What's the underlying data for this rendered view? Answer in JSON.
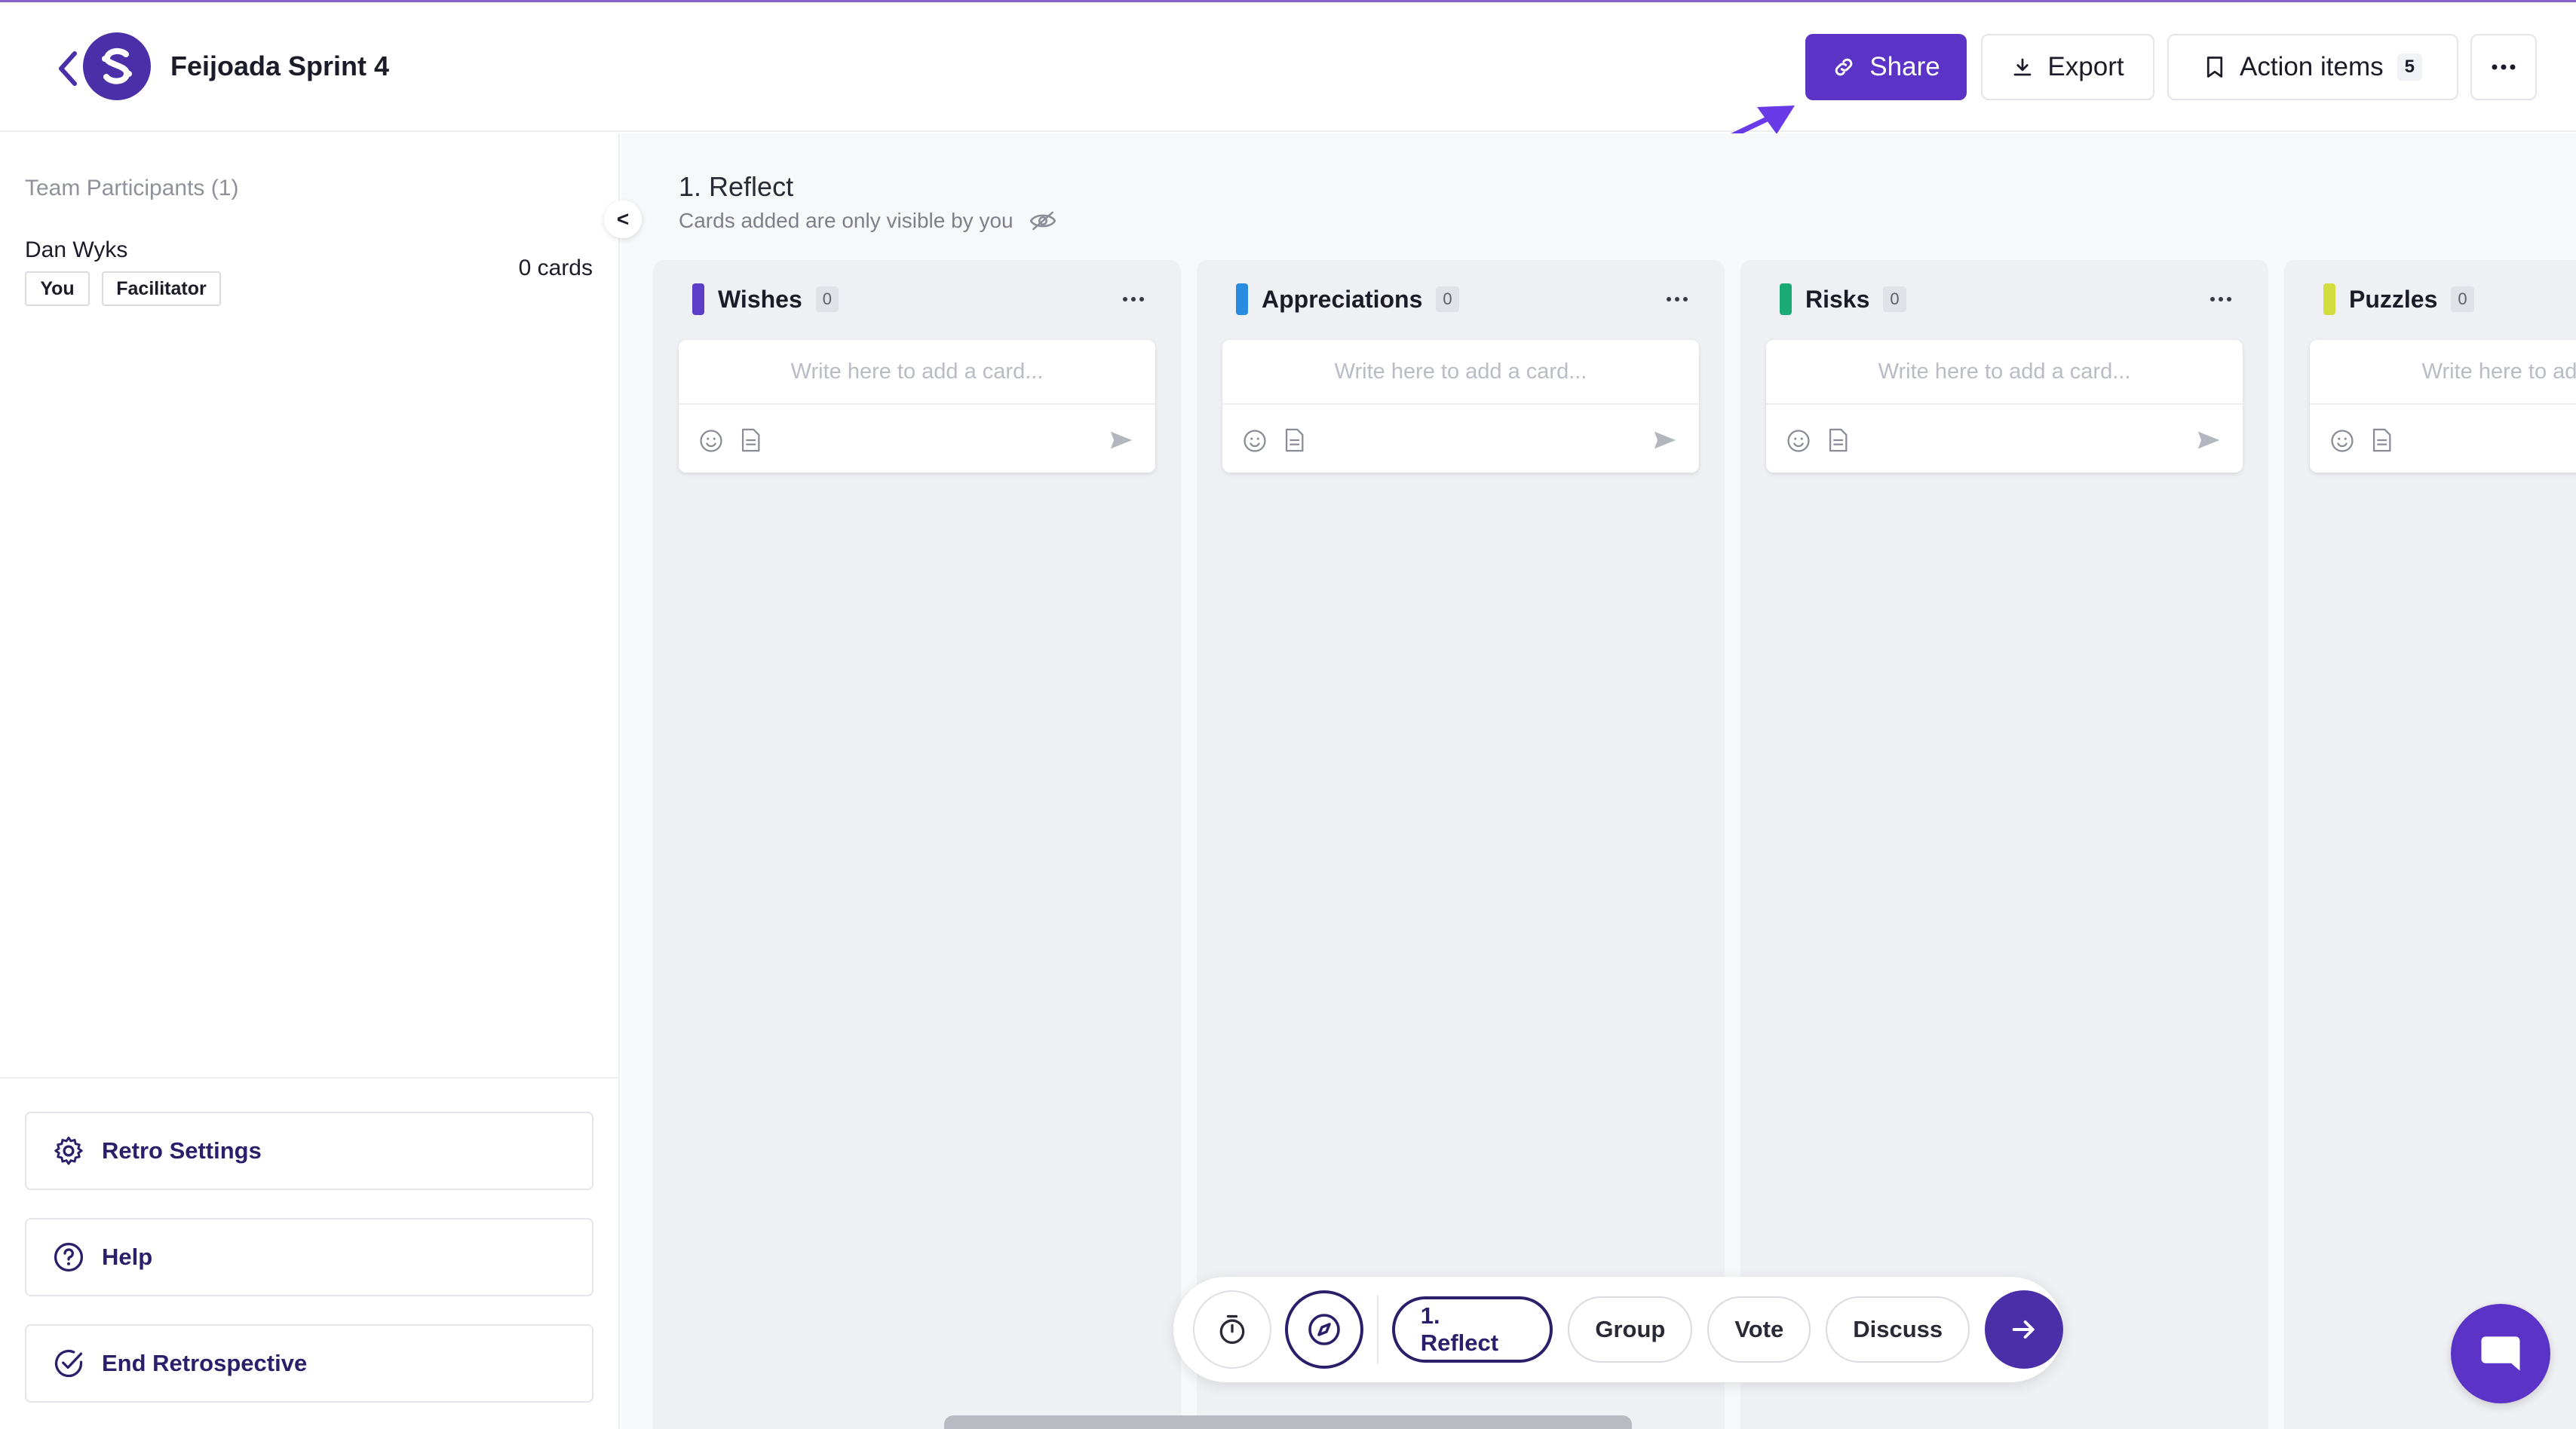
{
  "header": {
    "board_title": "Feijoada Sprint 4",
    "share_label": "Share",
    "export_label": "Export",
    "action_items_label": "Action items",
    "action_items_count": "5"
  },
  "sidebar": {
    "heading": "Team Participants (1)",
    "participant": {
      "name": "Dan Wyks",
      "cards": "0 cards",
      "tags": [
        "You",
        "Facilitator"
      ]
    },
    "collapse_label": "<",
    "actions": [
      "Retro Settings",
      "Help",
      "End Retrospective"
    ]
  },
  "phase": {
    "title": "1. Reflect",
    "subtitle": "Cards added are only visible by you"
  },
  "columns": [
    {
      "title": "Wishes",
      "count": "0",
      "color": "#5b3fc7",
      "placeholder": "Write here to add a card..."
    },
    {
      "title": "Appreciations",
      "count": "0",
      "color": "#2a8ce0",
      "placeholder": "Write here to add a card..."
    },
    {
      "title": "Risks",
      "count": "0",
      "color": "#1aaa76",
      "placeholder": "Write here to add a card..."
    },
    {
      "title": "Puzzles",
      "count": "0",
      "color": "#d4dd3e",
      "placeholder": "Write here to add a card..."
    }
  ],
  "phase_bar": {
    "steps": [
      "1. Reflect",
      "Group",
      "Vote",
      "Discuss"
    ],
    "active": "1. Reflect"
  },
  "colors": {
    "primary": "#5b34c7",
    "dark_primary": "#4b2fa8",
    "annotation_arrow": "#6a3ae8"
  },
  "icons": {
    "back": "chevron-left-icon",
    "logo": "retro-logo-icon",
    "share": "link-icon",
    "export": "download-icon",
    "action_items": "bookmark-icon",
    "more": "more-horizontal-icon",
    "visibility": "eye-off-icon",
    "settings": "gear-icon",
    "help": "help-circle-icon",
    "end": "check-circle-icon",
    "timer": "timer-icon",
    "compass": "compass-icon",
    "next": "arrow-right-icon",
    "chat": "chat-icon"
  }
}
